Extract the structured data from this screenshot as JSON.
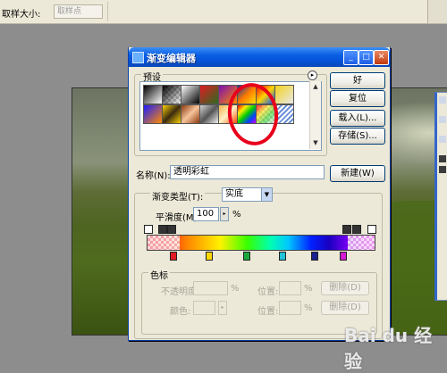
{
  "options_bar": {
    "sample_size_label": "取样大小:",
    "sample_size_value": "取样点"
  },
  "dialog": {
    "title": "渐变编辑器",
    "presets_label": "预设",
    "ok_label": "好",
    "reset_label": "复位",
    "load_label": "载入(L)...",
    "save_label": "存储(S)...",
    "name_label": "名称(N):",
    "name_value": "透明彩虹",
    "new_label": "新建(W)",
    "gradient_type_label": "渐变类型(T):",
    "gradient_type_value": "实底",
    "smoothness_label": "平滑度(M):",
    "smoothness_value": "100",
    "smoothness_unit": "%",
    "stops_group_label": "色标",
    "opacity_label": "不透明度:",
    "opacity_unit": "%",
    "position_label": "位置:",
    "position_unit": "%",
    "delete_label": "删除(D)",
    "color_label": "颜色:",
    "position2_label": "位置:",
    "position2_unit": "%",
    "delete2_label": "删除(D)"
  },
  "colors": {
    "title_bar": "#0553d7",
    "annotation_circle": "#e8001b",
    "panel_bg": "#ece9d8"
  },
  "watermark": "Bai du 经验"
}
